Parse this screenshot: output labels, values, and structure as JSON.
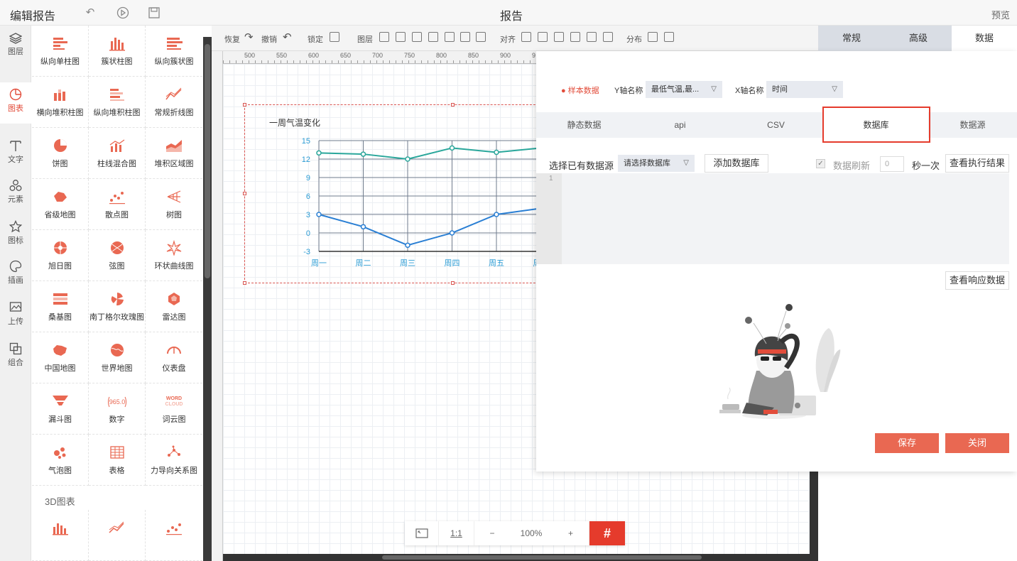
{
  "header": {
    "title": "编辑报告",
    "center_title": "报告",
    "preview": "预览"
  },
  "left_nav": [
    {
      "label": "图层",
      "icon": "layers-icon"
    },
    {
      "label": "图表",
      "icon": "chart-icon"
    },
    {
      "label": "文字",
      "icon": "text-icon"
    },
    {
      "label": "元素",
      "icon": "elements-icon"
    },
    {
      "label": "图标",
      "icon": "star-icon"
    },
    {
      "label": "插画",
      "icon": "palette-icon"
    },
    {
      "label": "上传",
      "icon": "upload-icon"
    },
    {
      "label": "组合",
      "icon": "group-icon"
    }
  ],
  "chart_types": [
    "纵向单柱图",
    "簇状柱图",
    "纵向簇状图",
    "横向堆积柱图",
    "纵向堆积柱图",
    "常规折线图",
    "饼图",
    "柱线混合图",
    "堆积区域图",
    "省级地图",
    "散点图",
    "树图",
    "旭日图",
    "弦图",
    "环状曲线图",
    "桑基图",
    "南丁格尔玫瑰图",
    "雷达图",
    "中国地图",
    "世界地图",
    "仪表盘",
    "漏斗图",
    "数字",
    "词云图",
    "气泡图",
    "表格",
    "力导向关系图"
  ],
  "section_3d": "3D图表",
  "toolbar": {
    "redo": "恢复",
    "undo": "撤销",
    "lock": "锁定",
    "layer": "图层",
    "align": "对齐",
    "distribute": "分布"
  },
  "ruler_labels": [
    "500",
    "550",
    "600",
    "650",
    "700",
    "750",
    "800",
    "850",
    "900",
    "9"
  ],
  "widget": {
    "chart_title": "一周气温变化"
  },
  "chart_data": {
    "type": "line",
    "title": "一周气温变化",
    "categories": [
      "周一",
      "周二",
      "周三",
      "周四",
      "周五",
      "周六"
    ],
    "yticks": [
      "15",
      "12",
      "9",
      "6",
      "3",
      "0",
      "-3"
    ],
    "ylim": [
      -3,
      15
    ],
    "series": [
      {
        "values": [
          13,
          12.8,
          12,
          13.8,
          13.1,
          13.8
        ],
        "color": "#2aa79b"
      },
      {
        "values": [
          3,
          1,
          -2,
          0,
          3,
          4
        ],
        "color": "#2a7fd4"
      }
    ]
  },
  "zoom": {
    "fit": "⤢",
    "ratio": "1:1",
    "minus": "−",
    "value": "100%",
    "plus": "+",
    "grid": "#"
  },
  "right_tabs": [
    "常规",
    "高级",
    "数据"
  ],
  "dialog": {
    "sample": "样本数据",
    "y_label": "Y轴名称",
    "y_value": "最低气温,最...",
    "x_label": "X轴名称",
    "x_value": "时间",
    "tabs": [
      "静态数据",
      "api",
      "CSV",
      "数据库",
      "数据源"
    ],
    "select_source_label": "选择已有数据源",
    "select_db": "请选择数据库",
    "add_db": "添加数据库",
    "refresh_label": "数据刷新",
    "refresh_value": "0",
    "per_second": "秒一次",
    "view_exec": "查看执行结果",
    "line_no": "1",
    "view_response": "查看响应数据",
    "save": "保存",
    "close": "关闭"
  },
  "colors": {
    "accent": "#e96852",
    "brand_red": "#e24d3b",
    "highlight": "#e53b2c"
  }
}
